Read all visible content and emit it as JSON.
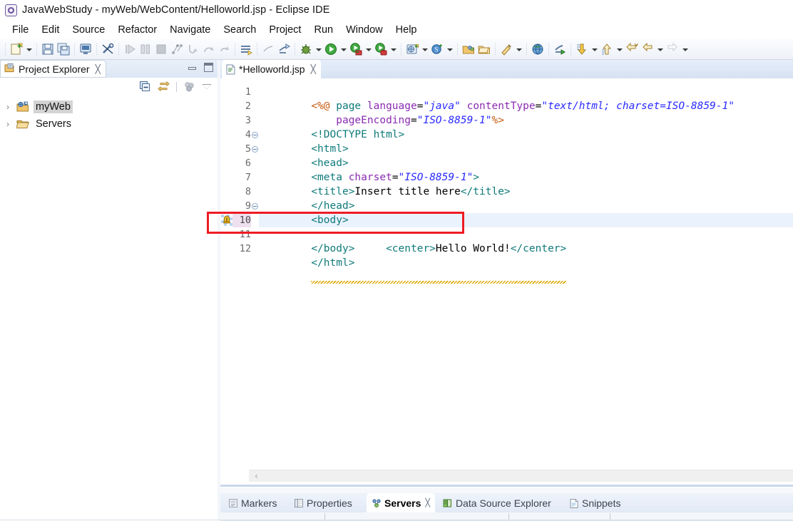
{
  "window": {
    "title": "JavaWebStudy - myWeb/WebContent/Helloworld.jsp - Eclipse IDE",
    "icon": "eclipse-icon"
  },
  "menubar": {
    "items": [
      {
        "label": "File",
        "name": "menu-file"
      },
      {
        "label": "Edit",
        "name": "menu-edit"
      },
      {
        "label": "Source",
        "name": "menu-source"
      },
      {
        "label": "Refactor",
        "name": "menu-refactor"
      },
      {
        "label": "Navigate",
        "name": "menu-navigate"
      },
      {
        "label": "Search",
        "name": "menu-search"
      },
      {
        "label": "Project",
        "name": "menu-project"
      },
      {
        "label": "Run",
        "name": "menu-run"
      },
      {
        "label": "Window",
        "name": "menu-window"
      },
      {
        "label": "Help",
        "name": "menu-help"
      }
    ]
  },
  "toolbar": {
    "items": [
      "new-wizard-icon",
      "new-dropdown-arrow",
      "save-icon",
      "save-all-icon",
      "sep",
      "open-console-icon",
      "sep",
      "toggle-breadcrumb-icon",
      "sep",
      "resume-icon",
      "suspend-icon",
      "terminate-icon",
      "disconnect-icon",
      "step-into-icon",
      "step-over-icon",
      "step-return-icon",
      "sep",
      "skip-breakpoints-icon",
      "sep",
      "run-last-tool-icon",
      "debug-icon",
      "debug-dropdown-arrow",
      "run-icon",
      "run-dropdown-arrow",
      "run-as-server-icon",
      "run-server-dropdown-arrow",
      "profile-icon",
      "profile-dropdown-arrow",
      "sep",
      "new-web-project-icon",
      "web-dropdown-arrow",
      "new-server-icon",
      "server-dropdown-arrow",
      "sep",
      "open-type-icon",
      "open-task-icon",
      "sep",
      "search-icon",
      "search-dropdown-arrow",
      "sep",
      "open-web-browser-icon",
      "sep",
      "external-tools-icon",
      "sep",
      "next-annotation-icon",
      "next-annotation-arrow",
      "previous-annotation-icon",
      "previous-annotation-arrow",
      "last-edit-location-icon",
      "back-icon",
      "back-dropdown-arrow",
      "forward-icon",
      "forward-dropdown-arrow"
    ]
  },
  "project_explorer": {
    "tab_label": "Project Explorer",
    "tab_icon": "project-explorer-icon",
    "close_glyph": "╳",
    "window_buttons": [
      "minimize-button",
      "maximize-button"
    ],
    "view_toolbar": [
      "collapse-all-icon",
      "link-with-editor-icon",
      "separator",
      "focus-on-active-task-icon",
      "view-menu-icon"
    ],
    "tree": [
      {
        "label": "myWeb",
        "icon": "dynamic-web-project-icon",
        "expander": "›",
        "selected": true
      },
      {
        "label": "Servers",
        "icon": "folder-icon",
        "expander": "›",
        "selected": false
      }
    ]
  },
  "editor": {
    "tab": {
      "label": "*Helloworld.jsp",
      "icon": "jsp-file-icon",
      "close_glyph": "╳",
      "dirty": true
    },
    "current_line": 10,
    "scrollbar": {
      "left_arrow": "‹"
    },
    "lines": [
      {
        "num": "1",
        "fold": false,
        "marker": null,
        "tokens": [
          {
            "t": "<%@ ",
            "c": "dir"
          },
          {
            "t": "page ",
            "c": "tag"
          },
          {
            "t": "language",
            "c": "attr"
          },
          {
            "t": "=",
            "c": "txt"
          },
          {
            "t": "\"java\"",
            "c": "str"
          },
          {
            "t": " ",
            "c": "txt"
          },
          {
            "t": "contentType",
            "c": "attr"
          },
          {
            "t": "=",
            "c": "txt"
          },
          {
            "t": "\"text/html; charset=ISO-8859-1\"",
            "c": "str"
          }
        ]
      },
      {
        "num": "2",
        "fold": false,
        "marker": null,
        "tokens": [
          {
            "t": "    ",
            "c": "txt"
          },
          {
            "t": "pageEncoding",
            "c": "attr"
          },
          {
            "t": "=",
            "c": "txt"
          },
          {
            "t": "\"ISO-8859-1\"",
            "c": "str"
          },
          {
            "t": "%>",
            "c": "dir"
          }
        ]
      },
      {
        "num": "3",
        "fold": false,
        "marker": null,
        "tokens": [
          {
            "t": "<!DOCTYPE html>",
            "c": "doc"
          }
        ]
      },
      {
        "num": "4",
        "fold": true,
        "marker": null,
        "tokens": [
          {
            "t": "<html>",
            "c": "tag"
          }
        ]
      },
      {
        "num": "5",
        "fold": true,
        "marker": null,
        "tokens": [
          {
            "t": "<head>",
            "c": "tag"
          }
        ]
      },
      {
        "num": "6",
        "fold": false,
        "marker": null,
        "tokens": [
          {
            "t": "<meta ",
            "c": "tag"
          },
          {
            "t": "charset",
            "c": "attr"
          },
          {
            "t": "=",
            "c": "txt"
          },
          {
            "t": "\"ISO-8859-1\"",
            "c": "str"
          },
          {
            "t": ">",
            "c": "tag"
          }
        ]
      },
      {
        "num": "7",
        "fold": false,
        "marker": null,
        "tokens": [
          {
            "t": "<title>",
            "c": "tag"
          },
          {
            "t": "Insert title here",
            "c": "txt"
          },
          {
            "t": "</title>",
            "c": "tag"
          }
        ]
      },
      {
        "num": "8",
        "fold": false,
        "marker": null,
        "tokens": [
          {
            "t": "</head>",
            "c": "tag"
          }
        ]
      },
      {
        "num": "9",
        "fold": true,
        "marker": null,
        "tokens": [
          {
            "t": "<body>",
            "c": "tag"
          }
        ]
      },
      {
        "num": "10",
        "fold": false,
        "marker": "warning-marker-icon",
        "current": true,
        "warning": true,
        "tokens": [
          {
            "t": "<center>",
            "c": "tag"
          },
          {
            "t": "Hello World!",
            "c": "txt"
          },
          {
            "t": "</center>",
            "c": "tag"
          }
        ]
      },
      {
        "num": "11",
        "fold": false,
        "marker": null,
        "tokens": [
          {
            "t": "</body>",
            "c": "tag"
          }
        ]
      },
      {
        "num": "12",
        "fold": false,
        "marker": null,
        "tokens": [
          {
            "t": "</html>",
            "c": "tag"
          }
        ]
      }
    ]
  },
  "bottom_panel": {
    "tabs": [
      {
        "label": "Markers",
        "icon": "markers-icon",
        "active": false
      },
      {
        "label": "Properties",
        "icon": "properties-icon",
        "active": false
      },
      {
        "label": "Servers",
        "icon": "servers-icon",
        "active": true,
        "close_glyph": "╳"
      },
      {
        "label": "Data Source Explorer",
        "icon": "data-source-explorer-icon",
        "active": false
      },
      {
        "label": "Snippets",
        "icon": "snippets-icon",
        "active": false
      }
    ]
  },
  "annotation": {
    "type": "red-rectangle-highlight",
    "target_line": 10
  },
  "colors": {
    "tag": "#0f7a7a",
    "attribute": "#8a2bb2",
    "string": "#2a2aff",
    "directive": "#c85a10",
    "text": "#000000",
    "current_line_highlight": "#eaf2fd",
    "current_line_number_bg": "#efe0f0",
    "annotation_red": "#ee1c25",
    "warning_squiggle": "#e0a800"
  }
}
